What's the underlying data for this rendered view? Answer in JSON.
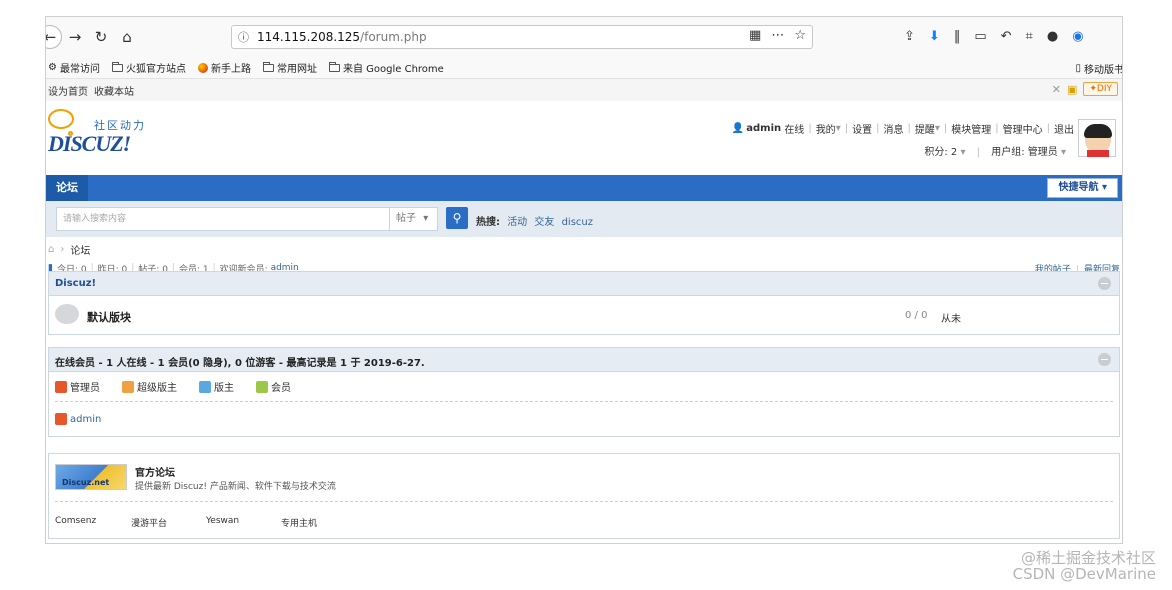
{
  "browser": {
    "url_host": "114.115.208.125",
    "url_path": "/forum.php",
    "bookmarks": [
      "最常访问",
      "火狐官方站点",
      "新手上路",
      "常用网址",
      "来自 Google Chrome"
    ],
    "mobile_bookmark": "移动版书"
  },
  "topbar": {
    "links": [
      "设为首页",
      "收藏本站"
    ],
    "diy": "✦DIY"
  },
  "header": {
    "logo_tagline": "社区动力",
    "logo_brand": "DISCUZ!",
    "user": {
      "name": "admin",
      "status": "在线",
      "menu": [
        "我的",
        "设置",
        "消息",
        "提醒",
        "模块管理",
        "管理中心",
        "退出"
      ],
      "points_label": "积分: 2",
      "group_label": "用户组: 管理员"
    }
  },
  "nav": {
    "active_tab": "论坛",
    "quick_nav": "快捷导航"
  },
  "search": {
    "placeholder": "请输入搜索内容",
    "type": "帖子",
    "hot_label": "热搜:",
    "hot_terms": [
      "活动",
      "交友",
      "discuz"
    ]
  },
  "breadcrumb": {
    "current": "论坛"
  },
  "stats": {
    "today": "今日: 0",
    "yesterday": "昨日: 0",
    "posts": "帖子: 0",
    "members": "会员: 1",
    "welcome": "欢迎新会员:",
    "newest_member": "admin",
    "my_posts": "我的帖子",
    "latest_replies": "最新回复"
  },
  "category": {
    "title": "Discuz!",
    "forums": [
      {
        "name": "默认版块",
        "count": "0 / 0",
        "last_post": "从未"
      }
    ]
  },
  "online": {
    "title": "在线会员 - 1 人在线 - 1 会员(0 隐身), 0 位游客 - 最高记录是 1 于 2019-6-27.",
    "groups": [
      {
        "label": "管理员",
        "color": "#e8572b"
      },
      {
        "label": "超级版主",
        "color": "#f0a040"
      },
      {
        "label": "版主",
        "color": "#5aa8e0"
      },
      {
        "label": "会员",
        "color": "#9cc84a"
      }
    ],
    "users": [
      "admin"
    ]
  },
  "links": {
    "badge_text": "Discuz.net",
    "title": "官方论坛",
    "description": "提供最新 Discuz! 产品新闻、软件下载与技术交流",
    "partners": [
      "Comsenz",
      "漫游平台",
      "Yeswan",
      "专用主机"
    ]
  },
  "watermark": {
    "line1": "@稀土掘金技术社区",
    "line2": "CSDN @DevMarine"
  }
}
